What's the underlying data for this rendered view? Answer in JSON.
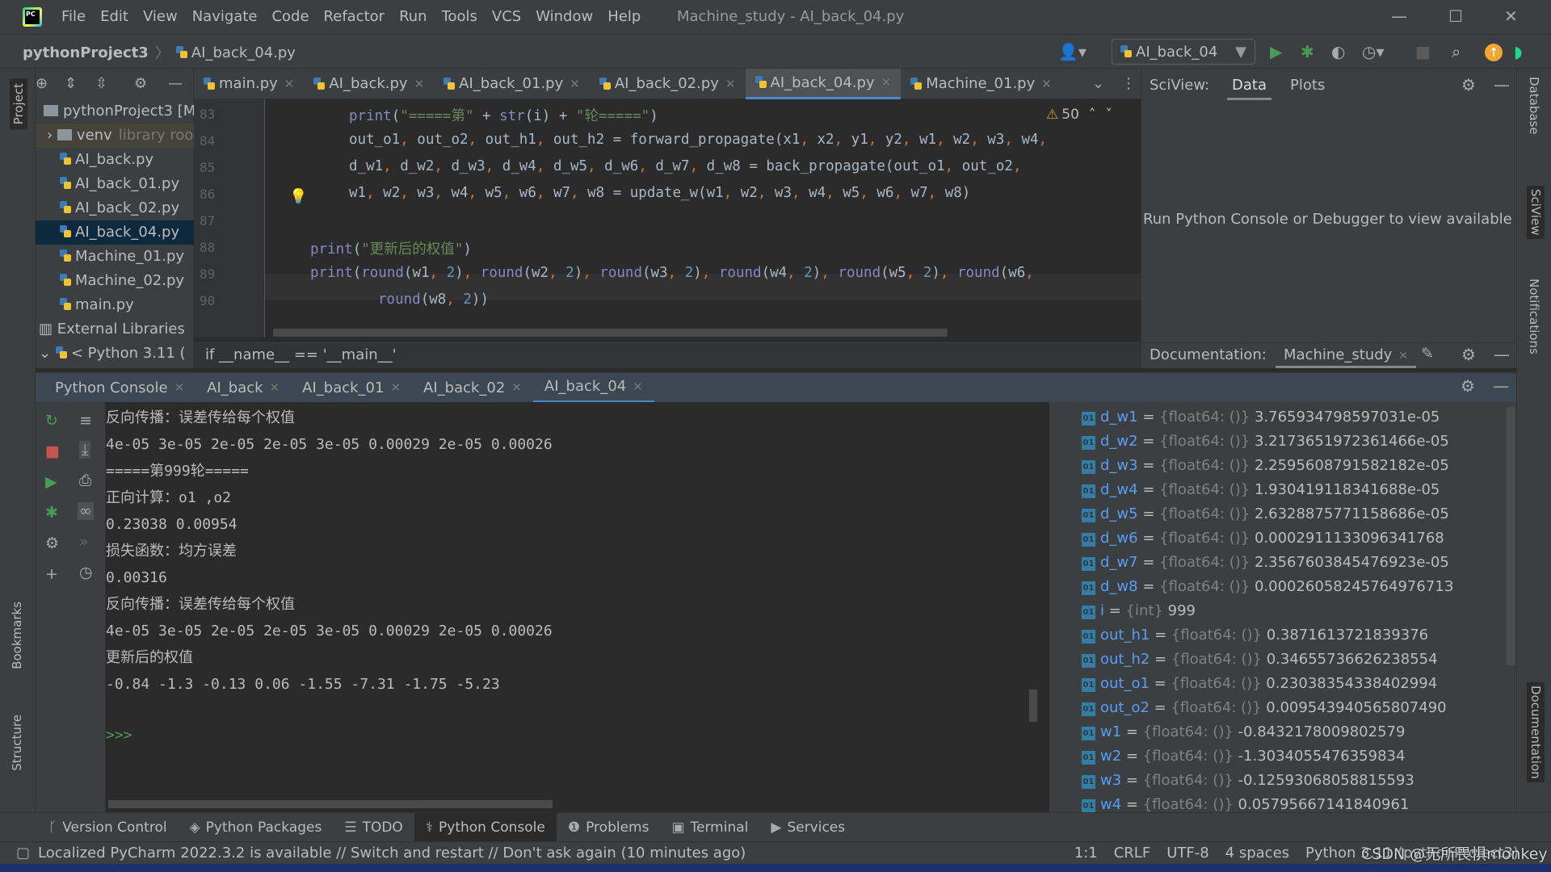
{
  "window": {
    "title": "Machine_study - AI_back_04.py",
    "menu": [
      "File",
      "Edit",
      "View",
      "Navigate",
      "Code",
      "Refactor",
      "Run",
      "Tools",
      "VCS",
      "Window",
      "Help"
    ]
  },
  "nav": {
    "project": "pythonProject3",
    "file": "AI_back_04.py",
    "run_config": "AI_back_04"
  },
  "project_panel": {
    "label": "Project",
    "items": [
      {
        "label": "pythonProject3 [M",
        "type": "folder"
      },
      {
        "label": "venv",
        "hint": "library root",
        "type": "folder"
      },
      {
        "label": "AI_back.py"
      },
      {
        "label": "AI_back_01.py"
      },
      {
        "label": "AI_back_02.py"
      },
      {
        "label": "AI_back_04.py",
        "selected": true
      },
      {
        "label": "Machine_01.py"
      },
      {
        "label": "Machine_02.py"
      },
      {
        "label": "main.py"
      },
      {
        "label": "External Libraries",
        "type": "lib"
      },
      {
        "label": "< Python 3.11 (",
        "type": "py"
      }
    ]
  },
  "editor": {
    "tabs": [
      {
        "label": "main.py"
      },
      {
        "label": "AI_back.py"
      },
      {
        "label": "AI_back_01.py"
      },
      {
        "label": "AI_back_02.py"
      },
      {
        "label": "AI_back_04.py",
        "active": true
      },
      {
        "label": "Machine_01.py"
      }
    ],
    "warnings": "50",
    "lines": [
      {
        "n": "83",
        "indent": 2,
        "tokens": [
          [
            "print",
            "fn"
          ],
          [
            "(",
            "t"
          ],
          [
            "\"=====第\"",
            "str"
          ],
          [
            " + ",
            "t"
          ],
          [
            "str",
            "fn"
          ],
          [
            "(i) + ",
            "t"
          ],
          [
            "\"轮=====\"",
            "str"
          ],
          [
            ")",
            "t"
          ]
        ]
      },
      {
        "n": "84",
        "indent": 2,
        "tokens": [
          [
            "out_o1",
            "t"
          ],
          [
            ", ",
            "p"
          ],
          [
            "out_o2",
            "t"
          ],
          [
            ", ",
            "p"
          ],
          [
            "out_h1",
            "t"
          ],
          [
            ", ",
            "p"
          ],
          [
            "out_h2 = forward_propagate(x1",
            "t"
          ],
          [
            ", ",
            "p"
          ],
          [
            "x2",
            "t"
          ],
          [
            ", ",
            "p"
          ],
          [
            "y1",
            "t"
          ],
          [
            ", ",
            "p"
          ],
          [
            "y2",
            "t"
          ],
          [
            ", ",
            "p"
          ],
          [
            "w1",
            "t"
          ],
          [
            ", ",
            "p"
          ],
          [
            "w2",
            "t"
          ],
          [
            ", ",
            "p"
          ],
          [
            "w3",
            "t"
          ],
          [
            ", ",
            "p"
          ],
          [
            "w4",
            "t"
          ],
          [
            ",",
            "p"
          ]
        ]
      },
      {
        "n": "85",
        "indent": 2,
        "tokens": [
          [
            "d_w1",
            "t"
          ],
          [
            ", ",
            "p"
          ],
          [
            "d_w2",
            "t"
          ],
          [
            ", ",
            "p"
          ],
          [
            "d_w3",
            "t"
          ],
          [
            ", ",
            "p"
          ],
          [
            "d_w4",
            "t"
          ],
          [
            ", ",
            "p"
          ],
          [
            "d_w5",
            "t"
          ],
          [
            ", ",
            "p"
          ],
          [
            "d_w6",
            "t"
          ],
          [
            ", ",
            "p"
          ],
          [
            "d_w7",
            "t"
          ],
          [
            ", ",
            "p"
          ],
          [
            "d_w8 = back_propagate(out_o1",
            "t"
          ],
          [
            ", ",
            "p"
          ],
          [
            "out_o2",
            "t"
          ],
          [
            ",",
            "p"
          ]
        ]
      },
      {
        "n": "86",
        "indent": 2,
        "tokens": [
          [
            "w1",
            "t"
          ],
          [
            ", ",
            "p"
          ],
          [
            "w2",
            "t"
          ],
          [
            ", ",
            "p"
          ],
          [
            "w3",
            "t"
          ],
          [
            ", ",
            "p"
          ],
          [
            "w4",
            "t"
          ],
          [
            ", ",
            "p"
          ],
          [
            "w5",
            "t"
          ],
          [
            ", ",
            "p"
          ],
          [
            "w6",
            "t"
          ],
          [
            ", ",
            "p"
          ],
          [
            "w7",
            "t"
          ],
          [
            ", ",
            "p"
          ],
          [
            "w8 = update_w(w1",
            "t"
          ],
          [
            ", ",
            "p"
          ],
          [
            "w2",
            "t"
          ],
          [
            ", ",
            "p"
          ],
          [
            "w3",
            "t"
          ],
          [
            ", ",
            "p"
          ],
          [
            "w4",
            "t"
          ],
          [
            ", ",
            "p"
          ],
          [
            "w5",
            "t"
          ],
          [
            ", ",
            "p"
          ],
          [
            "w6",
            "t"
          ],
          [
            ", ",
            "p"
          ],
          [
            "w7",
            "t"
          ],
          [
            ", ",
            "p"
          ],
          [
            "w8)",
            "t"
          ]
        ]
      },
      {
        "n": "87",
        "indent": 0,
        "tokens": []
      },
      {
        "n": "88",
        "indent": 1,
        "tokens": [
          [
            "print",
            "fn"
          ],
          [
            "(",
            "t"
          ],
          [
            "\"更新后的权值\"",
            "str"
          ],
          [
            ")",
            "t"
          ]
        ]
      },
      {
        "n": "89",
        "indent": 1,
        "tokens": [
          [
            "print",
            "fn"
          ],
          [
            "(",
            "t"
          ],
          [
            "round",
            "fn"
          ],
          [
            "(w1",
            "t"
          ],
          [
            ", ",
            "p"
          ],
          [
            "2",
            "num"
          ],
          [
            ")",
            "t"
          ],
          [
            ", ",
            "p"
          ],
          [
            "round",
            "fn"
          ],
          [
            "(w2",
            "t"
          ],
          [
            ", ",
            "p"
          ],
          [
            "2",
            "num"
          ],
          [
            ")",
            "t"
          ],
          [
            ", ",
            "p"
          ],
          [
            "round",
            "fn"
          ],
          [
            "(w3",
            "t"
          ],
          [
            ", ",
            "p"
          ],
          [
            "2",
            "num"
          ],
          [
            ")",
            "t"
          ],
          [
            ", ",
            "p"
          ],
          [
            "round",
            "fn"
          ],
          [
            "(w4",
            "t"
          ],
          [
            ", ",
            "p"
          ],
          [
            "2",
            "num"
          ],
          [
            ")",
            "t"
          ],
          [
            ", ",
            "p"
          ],
          [
            "round",
            "fn"
          ],
          [
            "(w5",
            "t"
          ],
          [
            ", ",
            "p"
          ],
          [
            "2",
            "num"
          ],
          [
            ")",
            "t"
          ],
          [
            ", ",
            "p"
          ],
          [
            "round",
            "fn"
          ],
          [
            "(w6",
            "t"
          ],
          [
            ",",
            "p"
          ]
        ]
      },
      {
        "n": "90",
        "indent": 3,
        "tokens": [
          [
            "round",
            "fn"
          ],
          [
            "(w8",
            "t"
          ],
          [
            ", ",
            "p"
          ],
          [
            "2",
            "num"
          ],
          [
            "))",
            "t"
          ]
        ]
      }
    ],
    "breadcrumb": "if __name__ == '__main__'"
  },
  "sciview": {
    "label": "SciView:",
    "tabs": [
      "Data",
      "Plots"
    ],
    "message": "Run Python Console or Debugger to view available da"
  },
  "documentation": {
    "label": "Documentation:",
    "tab": "Machine_study"
  },
  "right_strip": [
    "Database",
    "SciView",
    "Notifications",
    "Documentation"
  ],
  "left_strip": [
    "Project",
    "Bookmarks",
    "Structure"
  ],
  "console_tabs": [
    {
      "label": "Python Console"
    },
    {
      "label": "AI_back"
    },
    {
      "label": "AI_back_01"
    },
    {
      "label": "AI_back_02"
    },
    {
      "label": "AI_back_04",
      "active": true
    }
  ],
  "console_lines": [
    "反向传播：误差传给每个权值",
    "4e-05 3e-05 2e-05 2e-05 3e-05 0.00029 2e-05 0.00026",
    "=====第999轮=====",
    "正向计算：o1 ,o2",
    "0.23038 0.00954",
    "损失函数：均方误差",
    "0.00316",
    "反向传播：误差传给每个权值",
    "4e-05 3e-05 2e-05 2e-05 3e-05 0.00029 2e-05 0.00026",
    "更新后的权值",
    "-0.84 -1.3 -0.13 0.06 -1.55 -7.31 -1.75 -5.23"
  ],
  "console_prompt": ">>>",
  "variables": [
    {
      "name": "d_w1",
      "type": "{float64: ()}",
      "value": "3.765934798597031e-05"
    },
    {
      "name": "d_w2",
      "type": "{float64: ()}",
      "value": "3.2173651972361466e-05"
    },
    {
      "name": "d_w3",
      "type": "{float64: ()}",
      "value": "2.2595608791582182e-05"
    },
    {
      "name": "d_w4",
      "type": "{float64: ()}",
      "value": "1.930419118341688e-05"
    },
    {
      "name": "d_w5",
      "type": "{float64: ()}",
      "value": "2.6328875771158686e-05"
    },
    {
      "name": "d_w6",
      "type": "{float64: ()}",
      "value": "0.0002911133096341768"
    },
    {
      "name": "d_w7",
      "type": "{float64: ()}",
      "value": "2.3567603845476923e-05"
    },
    {
      "name": "d_w8",
      "type": "{float64: ()}",
      "value": "0.0002605824576497671З"
    },
    {
      "name": "i",
      "type": "{int}",
      "value": "999"
    },
    {
      "name": "out_h1",
      "type": "{float64: ()}",
      "value": "0.3871613721839376"
    },
    {
      "name": "out_h2",
      "type": "{float64: ()}",
      "value": "0.34655736626238554"
    },
    {
      "name": "out_o1",
      "type": "{float64: ()}",
      "value": "0.23038354338402994"
    },
    {
      "name": "out_o2",
      "type": "{float64: ()}",
      "value": "0.009543940565807490"
    },
    {
      "name": "w1",
      "type": "{float64: ()}",
      "value": "-0.8432178009802579"
    },
    {
      "name": "w2",
      "type": "{float64: ()}",
      "value": "-1.3034055476359834"
    },
    {
      "name": "w3",
      "type": "{float64: ()}",
      "value": "-0.12593068058815593"
    },
    {
      "name": "w4",
      "type": "{float64: ()}",
      "value": "0.05795667141840961"
    }
  ],
  "tool_windows": [
    {
      "label": "Version Control",
      "icon": "branch-icon"
    },
    {
      "label": "Python Packages",
      "icon": "packages-icon"
    },
    {
      "label": "TODO",
      "icon": "list-icon"
    },
    {
      "label": "Python Console",
      "icon": "python-icon",
      "active": true
    },
    {
      "label": "Problems",
      "icon": "problems-icon"
    },
    {
      "label": "Terminal",
      "icon": "terminal-icon"
    },
    {
      "label": "Services",
      "icon": "services-icon"
    }
  ],
  "status": {
    "message": "Localized PyCharm 2022.3.2 is available // Switch and restart // Don't ask again (10 minutes ago)",
    "position": "1:1",
    "line_sep": "CRLF",
    "encoding": "UTF-8",
    "indent": "4 spaces",
    "interpreter": "Python 3.11 (pythonProject3)"
  },
  "watermark": "CSDN @无所畏惧monkey",
  "colors": {
    "accent": "#4a88c7",
    "run": "#499c54",
    "variable": "#589df6"
  }
}
